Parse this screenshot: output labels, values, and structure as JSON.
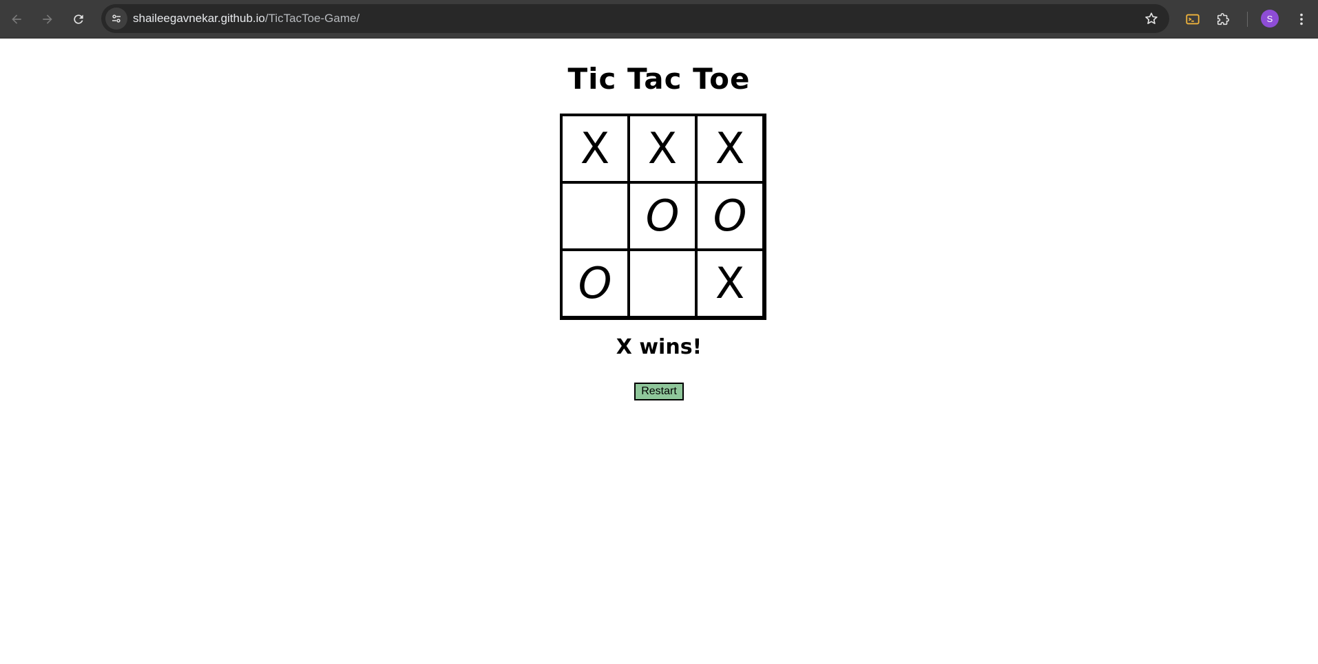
{
  "browser": {
    "url_host": "shaileegavnekar.github.io",
    "url_path": "/TicTacToe-Game/",
    "profile_initial": "S",
    "icons": {
      "back": "arrow-left-icon",
      "forward": "arrow-right-icon",
      "reload": "reload-icon",
      "site_info": "tune-icon",
      "bookmark": "star-icon",
      "extension_1": "cast-icon",
      "extensions": "puzzle-icon",
      "menu": "kebab-menu-icon"
    },
    "colors": {
      "toolbar": "#3c3c3c",
      "omnibox": "#282828",
      "avatar": "#8e4dd6",
      "extension_accent": "#f0b43c"
    }
  },
  "game": {
    "title": "Tic Tac Toe",
    "board": [
      [
        "X",
        "X",
        "X"
      ],
      [
        "",
        "O",
        "O"
      ],
      [
        "O",
        "",
        "X"
      ]
    ],
    "status": "X wins!",
    "restart_label": "Restart",
    "colors": {
      "restart_button": "#8fc69a",
      "grid": "#000000"
    }
  }
}
